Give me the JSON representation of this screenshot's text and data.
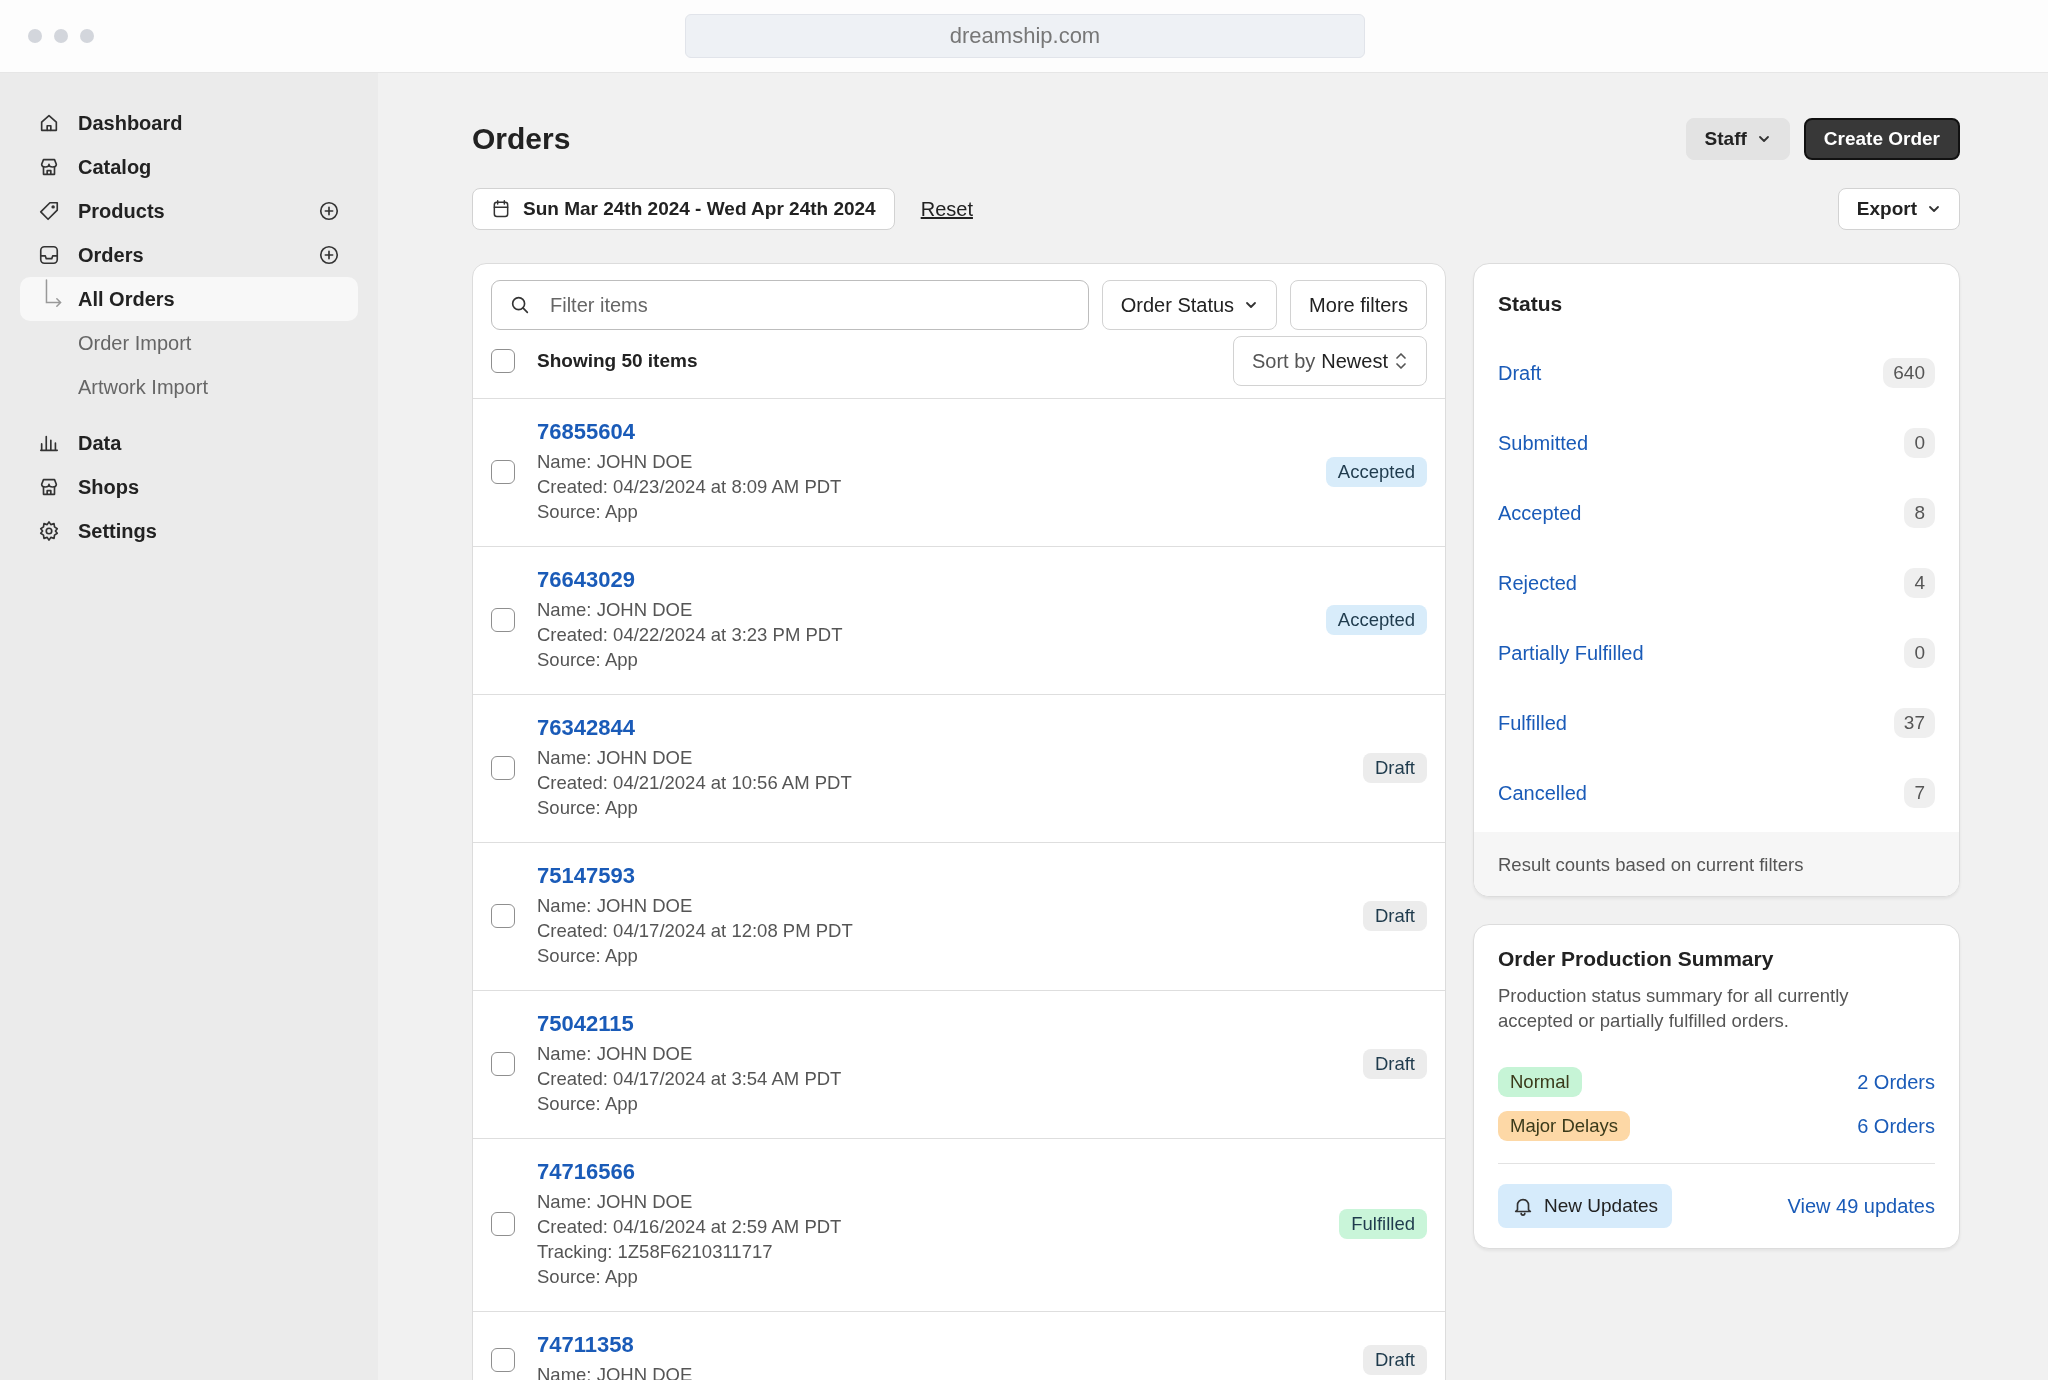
{
  "browser": {
    "url": "dreamship.com"
  },
  "sidebar": {
    "items": [
      {
        "label": "Dashboard",
        "selected": false
      },
      {
        "label": "Catalog",
        "selected": false
      },
      {
        "label": "Products",
        "selected": false,
        "addable": true
      },
      {
        "label": "Orders",
        "selected": false,
        "addable": true,
        "children": [
          {
            "label": "All Orders",
            "selected": true
          },
          {
            "label": "Order Import",
            "selected": false
          },
          {
            "label": "Artwork Import",
            "selected": false
          }
        ]
      },
      {
        "label": "Data",
        "selected": false
      },
      {
        "label": "Shops",
        "selected": false
      },
      {
        "label": "Settings",
        "selected": false
      }
    ]
  },
  "header": {
    "title": "Orders",
    "buttons": [
      {
        "label": "Staff",
        "kind": "dropdown"
      },
      {
        "label": "Create Order",
        "kind": "primary"
      }
    ]
  },
  "date_range": {
    "label": "Sun Mar 24th 2024 - Wed Apr 24th 2024",
    "reset": "Reset"
  },
  "export": {
    "label": "Export"
  },
  "orders": {
    "search": {
      "placeholder": "Filter items"
    },
    "filters": [
      "Order Status",
      "More filters"
    ],
    "select_all": {
      "checked": false,
      "label": "Showing 50 items"
    },
    "sort": {
      "prefix": "Sort by",
      "value": "Newest"
    },
    "rows": [
      {
        "number": "76855604",
        "checked": false,
        "lines": [
          "Name: JOHN DOE",
          "Created: 04/23/2024 at 8:09 AM PDT",
          "Source: App"
        ],
        "status": "Accepted",
        "color": "#d8ecfa"
      },
      {
        "number": "76643029",
        "checked": false,
        "lines": [
          "Name: JOHN DOE",
          "Created: 04/22/2024 at 3:23 PM PDT",
          "Source: App"
        ],
        "status": "Accepted",
        "color": "#d8ecfa"
      },
      {
        "number": "76342844",
        "checked": false,
        "lines": [
          "Name: JOHN DOE",
          "Created: 04/21/2024 at 10:56 AM PDT",
          "Source: App"
        ],
        "status": "Draft",
        "color": "#ececec"
      },
      {
        "number": "75147593",
        "checked": false,
        "lines": [
          "Name: JOHN DOE",
          "Created: 04/17/2024 at 12:08 PM PDT",
          "Source: App"
        ],
        "status": "Draft",
        "color": "#ececec"
      },
      {
        "number": "75042115",
        "checked": false,
        "lines": [
          "Name: JOHN DOE",
          "Created: 04/17/2024 at 3:54 AM PDT",
          "Source: App"
        ],
        "status": "Draft",
        "color": "#ececec"
      },
      {
        "number": "74716566",
        "checked": false,
        "lines": [
          "Name: JOHN DOE",
          "Created: 04/16/2024 at 2:59 AM PDT",
          "Tracking: 1Z58F6210311717",
          "Source: App"
        ],
        "status": "Fulfilled",
        "color": "#c9f5d9"
      },
      {
        "number": "74711358",
        "checked": false,
        "lines": [
          "Name: JOHN DOE"
        ],
        "status": "Draft",
        "color": "#ececec"
      }
    ]
  },
  "status": {
    "title": "Status",
    "items": [
      {
        "label": "Draft",
        "count": "640"
      },
      {
        "label": "Submitted",
        "count": "0"
      },
      {
        "label": "Accepted",
        "count": "8"
      },
      {
        "label": "Rejected",
        "count": "4"
      },
      {
        "label": "Partially Fulfilled",
        "count": "0"
      },
      {
        "label": "Fulfilled",
        "count": "37"
      },
      {
        "label": "Cancelled",
        "count": "7"
      }
    ],
    "footer": "Result counts based on current filters"
  },
  "production": {
    "title": "Order Production Summary",
    "description": "Production status summary for all currently accepted or partially fulfilled orders.",
    "items": [
      {
        "label": "Normal",
        "color": "#c6f4d6",
        "link": "2 Orders"
      },
      {
        "label": "Major Delays",
        "color": "#fdd8a6",
        "link": "6 Orders"
      }
    ],
    "updates": {
      "label": "New Updates",
      "link": "View 49 updates"
    }
  }
}
